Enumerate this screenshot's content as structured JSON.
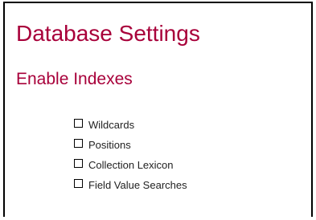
{
  "colors": {
    "heading": "#a8003a",
    "text": "#222222",
    "border": "#000000"
  },
  "page": {
    "title": "Database Settings"
  },
  "section": {
    "title": "Enable Indexes"
  },
  "options": [
    {
      "label": "Wildcards",
      "checked": false,
      "icon": "checkbox-unchecked-icon"
    },
    {
      "label": "Positions",
      "checked": false,
      "icon": "checkbox-unchecked-icon"
    },
    {
      "label": "Collection Lexicon",
      "checked": false,
      "icon": "checkbox-unchecked-icon"
    },
    {
      "label": "Field Value Searches",
      "checked": false,
      "icon": "checkbox-unchecked-icon"
    }
  ]
}
